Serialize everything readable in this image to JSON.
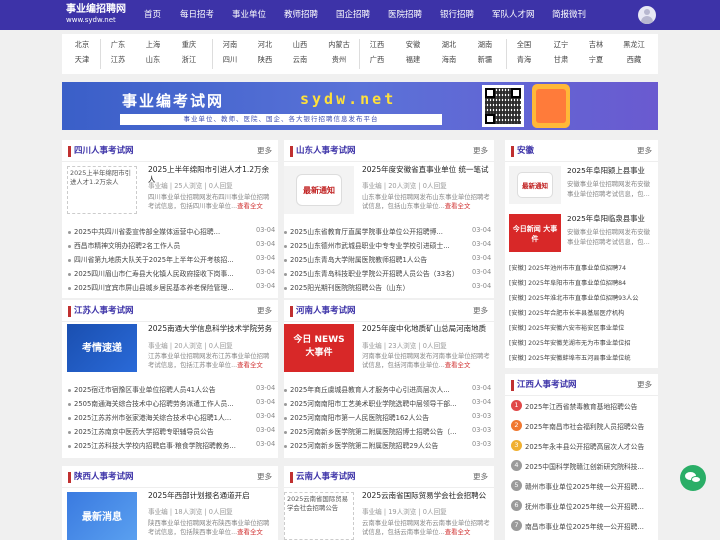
{
  "header": {
    "logo_title": "事业编招聘网",
    "logo_sub": "www.sydw.net",
    "nav": [
      "首页",
      "每日招考",
      "事业单位",
      "教师招聘",
      "国企招聘",
      "医院招聘",
      "银行招聘",
      "军队人才网",
      "简报微刊"
    ]
  },
  "regions": {
    "row1": [
      "北京",
      "广东",
      "上海",
      "重庆",
      "河南",
      "河北",
      "山西",
      "内蒙古",
      "江西",
      "安徽",
      "湖北",
      "湖南",
      "全国",
      "辽宁",
      "吉林",
      "黑龙江"
    ],
    "row2": [
      "天津",
      "江苏",
      "山东",
      "浙江",
      "四川",
      "陕西",
      "云南",
      "贵州",
      "广西",
      "福建",
      "海南",
      "新疆",
      "青海",
      "甘肃",
      "宁夏",
      "西藏"
    ]
  },
  "banner": {
    "title": "事业编考试网",
    "domain": "sydw.net",
    "tagline": "事业单位、教师、医院、国企、各大银行招聘信息发布平台"
  },
  "more": "更多",
  "read_all": "查看全文",
  "sichuan": {
    "title": "四川人事考试网",
    "feature": {
      "img_alt": "2025上半年绵阳市引进人才1.2万余人",
      "title": "2025上半年绵阳市引进人才1.2万余人",
      "meta": "事业编 | 25人浏览 | 0人回复",
      "desc": "四川事业单位招聘网发布四川事业单位招聘考试信息，包括四川事业单位..."
    },
    "rows": [
      {
        "t": "2025中共四川省委宣传部全媒体运营中心招聘...",
        "d": "03-04"
      },
      {
        "t": "西昌市精神文明办招聘2名工作人员",
        "d": "03-04"
      },
      {
        "t": "四川省第九地质大队关于2025年上半年公开考核招...",
        "d": "03-04"
      },
      {
        "t": "2025四川眉山市仁寿县大化镇人民政府接收下岗事...",
        "d": "03-04"
      },
      {
        "t": "2025四川宜宾市屏山县城乡居民基本养老保险管理...",
        "d": "03-04"
      }
    ]
  },
  "shandong": {
    "title": "山东人事考试网",
    "feature": {
      "badge": "最新通知",
      "title": "2025年度安徽省直事业单位 统一笔试",
      "meta": "事业编 | 20人浏览 | 0人回复",
      "desc": "山东事业单位招聘网发布山东事业单位招聘考试信息，包括山东事业单位..."
    },
    "rows": [
      {
        "t": "2025山东省教育厅直属学院事业单位公开招聘博...",
        "d": "03-04"
      },
      {
        "t": "2025山东德州市武城县职业中专专业学校引进硕士...",
        "d": "03-04"
      },
      {
        "t": "2025山东青岛大学附属医院教师招聘1人公告",
        "d": "03-04"
      },
      {
        "t": "2025山东青岛科技职业学院公开招聘人员公告（33名）",
        "d": "03-04"
      },
      {
        "t": "2025阳光期刊医院院招聘公告（山东）",
        "d": "03-04"
      }
    ]
  },
  "anhui": {
    "title": "安徽",
    "features": [
      {
        "badge": "最新通知",
        "title": "2025年阜阳颍上县事业",
        "desc": "安徽事业单位招聘网发布安徽事业单位招聘考试信息，包..."
      },
      {
        "badge": "今日新闻 大事件",
        "title": "2025年阜阳临泉县事业",
        "desc": "安徽事业单位招聘网发布安徽事业单位招聘考试信息，包..."
      }
    ],
    "rows": [
      "[安徽] 2025年池州市市直事业单位招聘74",
      "[安徽] 2025年阜阳市市直事业单位招聘84",
      "[安徽] 2025年淮北市市直事业单位招聘93人公",
      "[安徽] 2025年合肥市长丰县基层医疗机构",
      "[安徽] 2025年安徽六安市裕安区事业单位",
      "[安徽] 2025年安徽芜湖市无为市事业单位招",
      "[安徽] 2025年安徽蚌埠市五河县事业单位统"
    ]
  },
  "jiangsu": {
    "title": "江苏人事考试网",
    "feature": {
      "badge": "考情速递",
      "title": "2025南通大学信息科学技术学院劳务",
      "meta": "事业编 | 20人浏览 | 0人回复",
      "desc": "江苏事业单位招聘网发布江苏事业单位招聘考试信息，包括江苏事业单位..."
    },
    "rows": [
      {
        "t": "2025宿迁市宿豫区事业单位招聘人员41人公告",
        "d": "03-04"
      },
      {
        "t": "2505南通海关综合技术中心招聘劳务派遣工作人员...",
        "d": "03-04"
      },
      {
        "t": "2025江苏苏州市张家港海关综合技术中心招聘1人...",
        "d": "03-04"
      },
      {
        "t": "2025江苏南京中医药大学招聘专职辅导员公告",
        "d": "03-04"
      },
      {
        "t": "2025江苏科技大学校内招聘启事·粮食学院招聘教务...",
        "d": "03-04"
      }
    ]
  },
  "henan": {
    "title": "河南人事考试网",
    "feature": {
      "badge": "今日 NEWS 大事件",
      "title": "2025年度中化地质矿山总局河南地质",
      "meta": "事业编 | 23人浏览 | 0人回复",
      "desc": "河南事业单位招聘网发布河南事业单位招聘考试信息，包括河南事业单位..."
    },
    "rows": [
      {
        "t": "2025年商丘虞城县教育人才服务中心引进高层次人...",
        "d": "03-04"
      },
      {
        "t": "2025河南南阳市工艺美术职业学院选聘中层领导干部...",
        "d": "03-04"
      },
      {
        "t": "2025河南南阳市第一人民医院招聘162人公告",
        "d": "03-03"
      },
      {
        "t": "2025河南新乡医学院第二附属医院招博士招聘公告（...",
        "d": "03-03"
      },
      {
        "t": "2025河南新乡医学院第二附属医院招聘29人公告",
        "d": "03-03"
      }
    ]
  },
  "jiangxi": {
    "title": "江西人事考试网",
    "rows": [
      "2025年江西省禁毒教育基地招聘公告",
      "2025年南昌市社会福利院人员招聘公告",
      "2025年永丰县公开招聘高层次人才公告",
      "2025中国科学院赣江创新研究院科技...",
      "赣州市事业单位2025年统一公开招聘...",
      "抚州市事业单位2025年统一公开招聘...",
      "南昌市事业单位2025年统一公开招聘..."
    ],
    "num_colors": [
      "#e04848",
      "#f07830",
      "#f0b030",
      "#9a9a9a",
      "#9a9a9a",
      "#9a9a9a",
      "#9a9a9a"
    ]
  },
  "shaanxi": {
    "title": "陕西人事考试网",
    "feature": {
      "badge": "最新消息",
      "title": "2025年西部计划报名通道开启",
      "meta": "事业编 | 18人浏览 | 0人回复",
      "desc": "陕西事业单位招聘网发布陕西事业单位招聘考试信息，包括陕西事业单位..."
    }
  },
  "yunnan": {
    "title": "云南人事考试网",
    "feature": {
      "img_alt": "2025云南省国际贸易学会社会招聘公告",
      "title": "2025云南省国际贸易学会社会招聘公",
      "meta": "事业编 | 19人浏览 | 0人回复",
      "desc": "云南事业单位招聘网发布云南事业单位招聘考试信息，包括云南事业单位..."
    }
  }
}
